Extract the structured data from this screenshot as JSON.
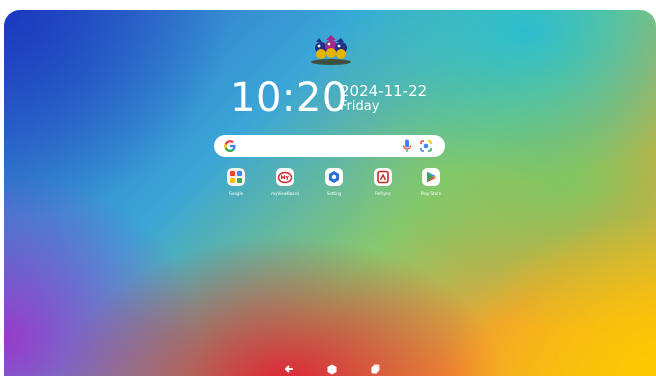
{
  "clock": {
    "time": "10:20",
    "date": "2024-11-22",
    "weekday": "Friday"
  },
  "search": {
    "placeholder": ""
  },
  "apps": [
    {
      "label": "Google",
      "icon": "google-folder-icon"
    },
    {
      "label": "myViewBoard",
      "icon": "myviewboard-icon"
    },
    {
      "label": "Setting",
      "icon": "settings-icon"
    },
    {
      "label": "Refsync",
      "icon": "refsync-icon"
    },
    {
      "label": "Play Store",
      "icon": "play-store-icon"
    }
  ],
  "navigation": {
    "back": "back-icon",
    "home": "home-icon",
    "recents": "recents-icon"
  },
  "colors": {
    "google_blue": "#4285F4",
    "google_red": "#EA4335",
    "google_yellow": "#FBBC05",
    "google_green": "#34A853",
    "myviewboard_red": "#d6282e"
  }
}
